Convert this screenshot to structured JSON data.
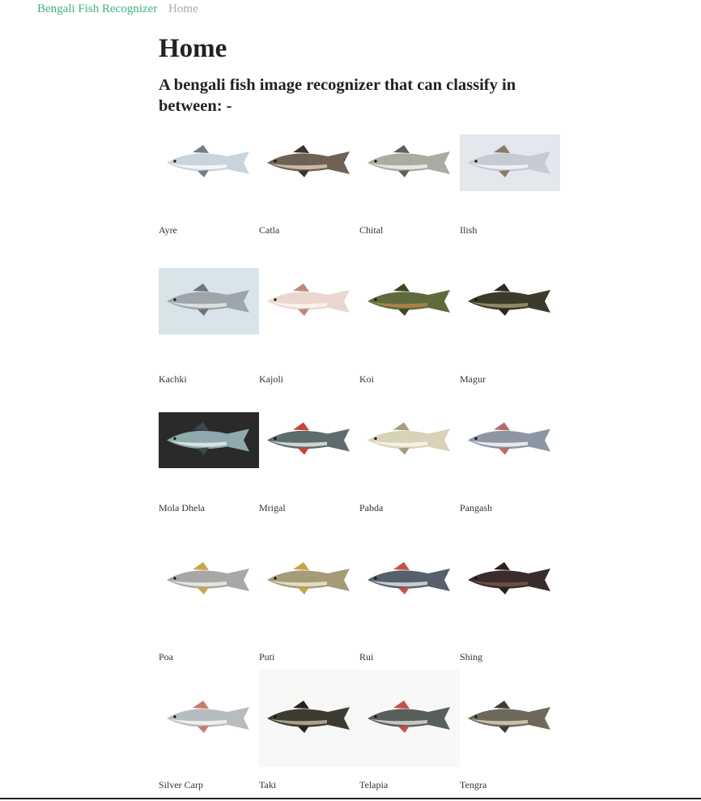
{
  "nav": {
    "brand": "Bengali Fish Recognizer",
    "home": "Home"
  },
  "page": {
    "title": "Home",
    "subtitle": "A bengali fish image recognizer that can classify in between: -"
  },
  "fish": [
    {
      "label": "Ayre",
      "icon": "fish-ayre-icon",
      "body": "#c9d4dd",
      "belly": "#f2f4f6",
      "fin": "#6d7f8c",
      "bg": "none"
    },
    {
      "label": "Catla",
      "icon": "fish-catla-icon",
      "body": "#6f6255",
      "belly": "#c9b9a6",
      "fin": "#3c342c",
      "bg": "none"
    },
    {
      "label": "Chital",
      "icon": "fish-chital-icon",
      "body": "#a9aca2",
      "belly": "#e6e6dc",
      "fin": "#5c6058",
      "bg": "none"
    },
    {
      "label": "Ilish",
      "icon": "fish-ilish-icon",
      "body": "#c6cad3",
      "belly": "#eef0f3",
      "fin": "#8a7a6c",
      "bg": "#e4e7ec"
    },
    {
      "label": "Kachki",
      "icon": "fish-kachki-icon",
      "body": "#9ea6aa",
      "belly": "#d9dedf",
      "fin": "#6f7579",
      "bg": "#d9e4ea"
    },
    {
      "label": "Kajoli",
      "icon": "fish-kajoli-icon",
      "body": "#ead7cf",
      "belly": "#fbf1ed",
      "fin": "#c0867a",
      "bg": "none"
    },
    {
      "label": "Koi",
      "icon": "fish-koi-icon",
      "body": "#5f6b3c",
      "belly": "#a9824a",
      "fin": "#3f4526",
      "bg": "none"
    },
    {
      "label": "Magur",
      "icon": "fish-magur-icon",
      "body": "#3c3a2a",
      "belly": "#8f8a63",
      "fin": "#2a2a1e",
      "bg": "none"
    },
    {
      "label": "Mola Dhela",
      "icon": "fish-mola-dhela-icon",
      "body": "#8fa9ae",
      "belly": "#d7e2e2",
      "fin": "#3b4a4c",
      "bg": "#2a2a2a"
    },
    {
      "label": "Mrigal",
      "icon": "fish-mrigal-icon",
      "body": "#5d6c6e",
      "belly": "#cfd5d3",
      "fin": "#c9423a",
      "bg": "none"
    },
    {
      "label": "Pabda",
      "icon": "fish-pabda-icon",
      "body": "#d9d2b8",
      "belly": "#f4f1e6",
      "fin": "#a49c7e",
      "bg": "none"
    },
    {
      "label": "Pangash",
      "icon": "fish-pangash-icon",
      "body": "#8d96a3",
      "belly": "#e7e9ee",
      "fin": "#b86a6a",
      "bg": "none"
    },
    {
      "label": "Poa",
      "icon": "fish-poa-icon",
      "body": "#a8a7a6",
      "belly": "#e6e3dd",
      "fin": "#c7a64b",
      "bg": "none"
    },
    {
      "label": "Puti",
      "icon": "fish-puti-icon",
      "body": "#a59b77",
      "belly": "#e3dcc2",
      "fin": "#c5a646",
      "bg": "none"
    },
    {
      "label": "Rui",
      "icon": "fish-rui-icon",
      "body": "#56606d",
      "belly": "#c7ccd3",
      "fin": "#c4524c",
      "bg": "none"
    },
    {
      "label": "Shing",
      "icon": "fish-shing-icon",
      "body": "#3a2c2a",
      "belly": "#6a4e46",
      "fin": "#2a201e",
      "bg": "none"
    },
    {
      "label": "Silver Carp",
      "icon": "fish-silver-carp-icon",
      "body": "#b7bcbe",
      "belly": "#eef0ef",
      "fin": "#c97a6a",
      "bg": "none"
    },
    {
      "label": "Taki",
      "icon": "fish-taki-icon",
      "body": "#3e3b33",
      "belly": "#a8a18b",
      "fin": "#26241f",
      "bg": "#f7f7f6"
    },
    {
      "label": "Telapia",
      "icon": "fish-telapia-icon",
      "body": "#59605c",
      "belly": "#c3c7c0",
      "fin": "#c54f4a",
      "bg": "#f8f8f8"
    },
    {
      "label": "Tengra",
      "icon": "fish-tengra-icon",
      "body": "#6d6a5c",
      "belly": "#c6c2ae",
      "fin": "#3f3c32",
      "bg": "none"
    }
  ]
}
